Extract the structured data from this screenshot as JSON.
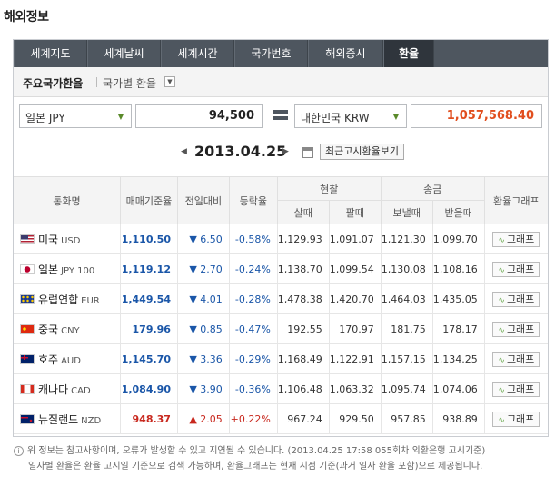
{
  "page_title": "해외정보",
  "tabs": [
    "세계지도",
    "세계날씨",
    "세계시간",
    "국가번호",
    "해외증시",
    "환율"
  ],
  "active_tab": "환율",
  "sub": {
    "title": "주요국가환율",
    "select": "국가별 환율"
  },
  "calculator": {
    "from_currency": "일본 JPY",
    "from_amount": "94,500",
    "to_currency": "대한민국 KRW",
    "to_amount": "1,057,568.40"
  },
  "date": "2013.04.25",
  "recent_button": "최근고시환율보기",
  "table": {
    "headers": {
      "currency": "통화명",
      "base_rate": "매매기준율",
      "change": "전일대비",
      "rate": "등락율",
      "cash": "현찰",
      "cash_buy": "살때",
      "cash_sell": "팔때",
      "remit": "송금",
      "remit_send": "보낼때",
      "remit_receive": "받을때",
      "graph": "환율그래프"
    },
    "rows": [
      {
        "name": "미국",
        "code": "USD",
        "flag": "us-flag",
        "base": "1,110.50",
        "change": "▼ 6.50",
        "rate": "-0.58%",
        "cash_buy": "1,129.93",
        "cash_sell": "1,091.07",
        "send": "1,121.30",
        "receive": "1,099.70",
        "graph": "그래프"
      },
      {
        "name": "일본",
        "code": "JPY 100",
        "flag": "jp-flag",
        "base": "1,119.12",
        "change": "▼ 2.70",
        "rate": "-0.24%",
        "cash_buy": "1,138.70",
        "cash_sell": "1,099.54",
        "send": "1,130.08",
        "receive": "1,108.16",
        "graph": "그래프"
      },
      {
        "name": "유럽연합",
        "code": "EUR",
        "flag": "eu-flag",
        "base": "1,449.54",
        "change": "▼ 4.01",
        "rate": "-0.28%",
        "cash_buy": "1,478.38",
        "cash_sell": "1,420.70",
        "send": "1,464.03",
        "receive": "1,435.05",
        "graph": "그래프"
      },
      {
        "name": "중국",
        "code": "CNY",
        "flag": "cn-flag",
        "base": "179.96",
        "change": "▼ 0.85",
        "rate": "-0.47%",
        "cash_buy": "192.55",
        "cash_sell": "170.97",
        "send": "181.75",
        "receive": "178.17",
        "graph": "그래프"
      },
      {
        "name": "호주",
        "code": "AUD",
        "flag": "au-flag",
        "base": "1,145.70",
        "change": "▼ 3.36",
        "rate": "-0.29%",
        "cash_buy": "1,168.49",
        "cash_sell": "1,122.91",
        "send": "1,157.15",
        "receive": "1,134.25",
        "graph": "그래프"
      },
      {
        "name": "캐나다",
        "code": "CAD",
        "flag": "ca-flag",
        "base": "1,084.90",
        "change": "▼ 3.90",
        "rate": "-0.36%",
        "cash_buy": "1,106.48",
        "cash_sell": "1,063.32",
        "send": "1,095.74",
        "receive": "1,074.06",
        "graph": "그래프"
      },
      {
        "name": "뉴질랜드",
        "code": "NZD",
        "flag": "nz-flag",
        "base": "948.37",
        "change": "▲ 2.05",
        "rate": "+0.22%",
        "cash_buy": "967.24",
        "cash_sell": "929.50",
        "send": "957.85",
        "receive": "938.89",
        "graph": "그래프"
      }
    ]
  },
  "notes": {
    "line1": "위 정보는 참고사항이며, 오류가 발생할 수 있고 지연될 수 있습니다. (2013.04.25 17:58 055회차 외환은행 고시기준)",
    "line2": "일자별 환율은 환율 고시일 기준으로 검색 가능하며, 환율그래프는 현재 시점 기준(과거 일자 환율 포함)으로 제공됩니다."
  },
  "colors": {
    "tab_bg": "#4e565f",
    "tab_active": "#2f353c",
    "down": "#1a56a8",
    "up": "#c8281e",
    "result": "#e14e1e"
  }
}
